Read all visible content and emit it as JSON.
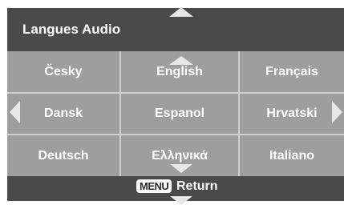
{
  "header": {
    "title": "Langues Audio"
  },
  "languages": [
    [
      "Česky",
      "English",
      "Français"
    ],
    [
      "Dansk",
      "Espanol",
      "Hrvatski"
    ],
    [
      "Deutsch",
      "Ελληνικά",
      "Italiano"
    ]
  ],
  "footer": {
    "menu_key": "MENU",
    "return_label": "Return"
  },
  "icons": {
    "scroll_up": "triangle-up-icon",
    "scroll_down": "triangle-down-icon",
    "page_left": "triangle-left-icon",
    "page_right": "triangle-right-icon"
  },
  "colors": {
    "header_bg": "#4a4a4a",
    "cell_bg": "#9e9e9e",
    "grid_lines": "#cfcfcf",
    "text": "#ffffff"
  }
}
